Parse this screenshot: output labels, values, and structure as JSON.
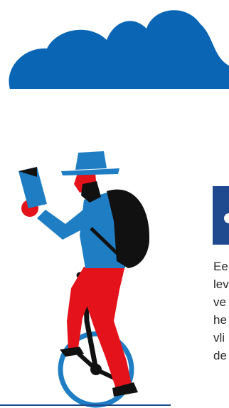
{
  "palette": {
    "cloud": "#0a66b5",
    "hat": "#1f7ec3",
    "shirt": "#1f7ec3",
    "skin_red": "#e4121b",
    "trousers": "#e4121b",
    "backpack": "#111111",
    "wheel": "#1f7ec3",
    "card_blue": "#1f4a8f",
    "text": "#2b2b2b"
  },
  "icons": {
    "cloud": "cloud-icon",
    "illustration": "unicycle-reader-illustration",
    "card": "card-icon"
  },
  "body_lines": [
    "Ee",
    "lev",
    "ve",
    "he",
    "vli",
    "de"
  ]
}
